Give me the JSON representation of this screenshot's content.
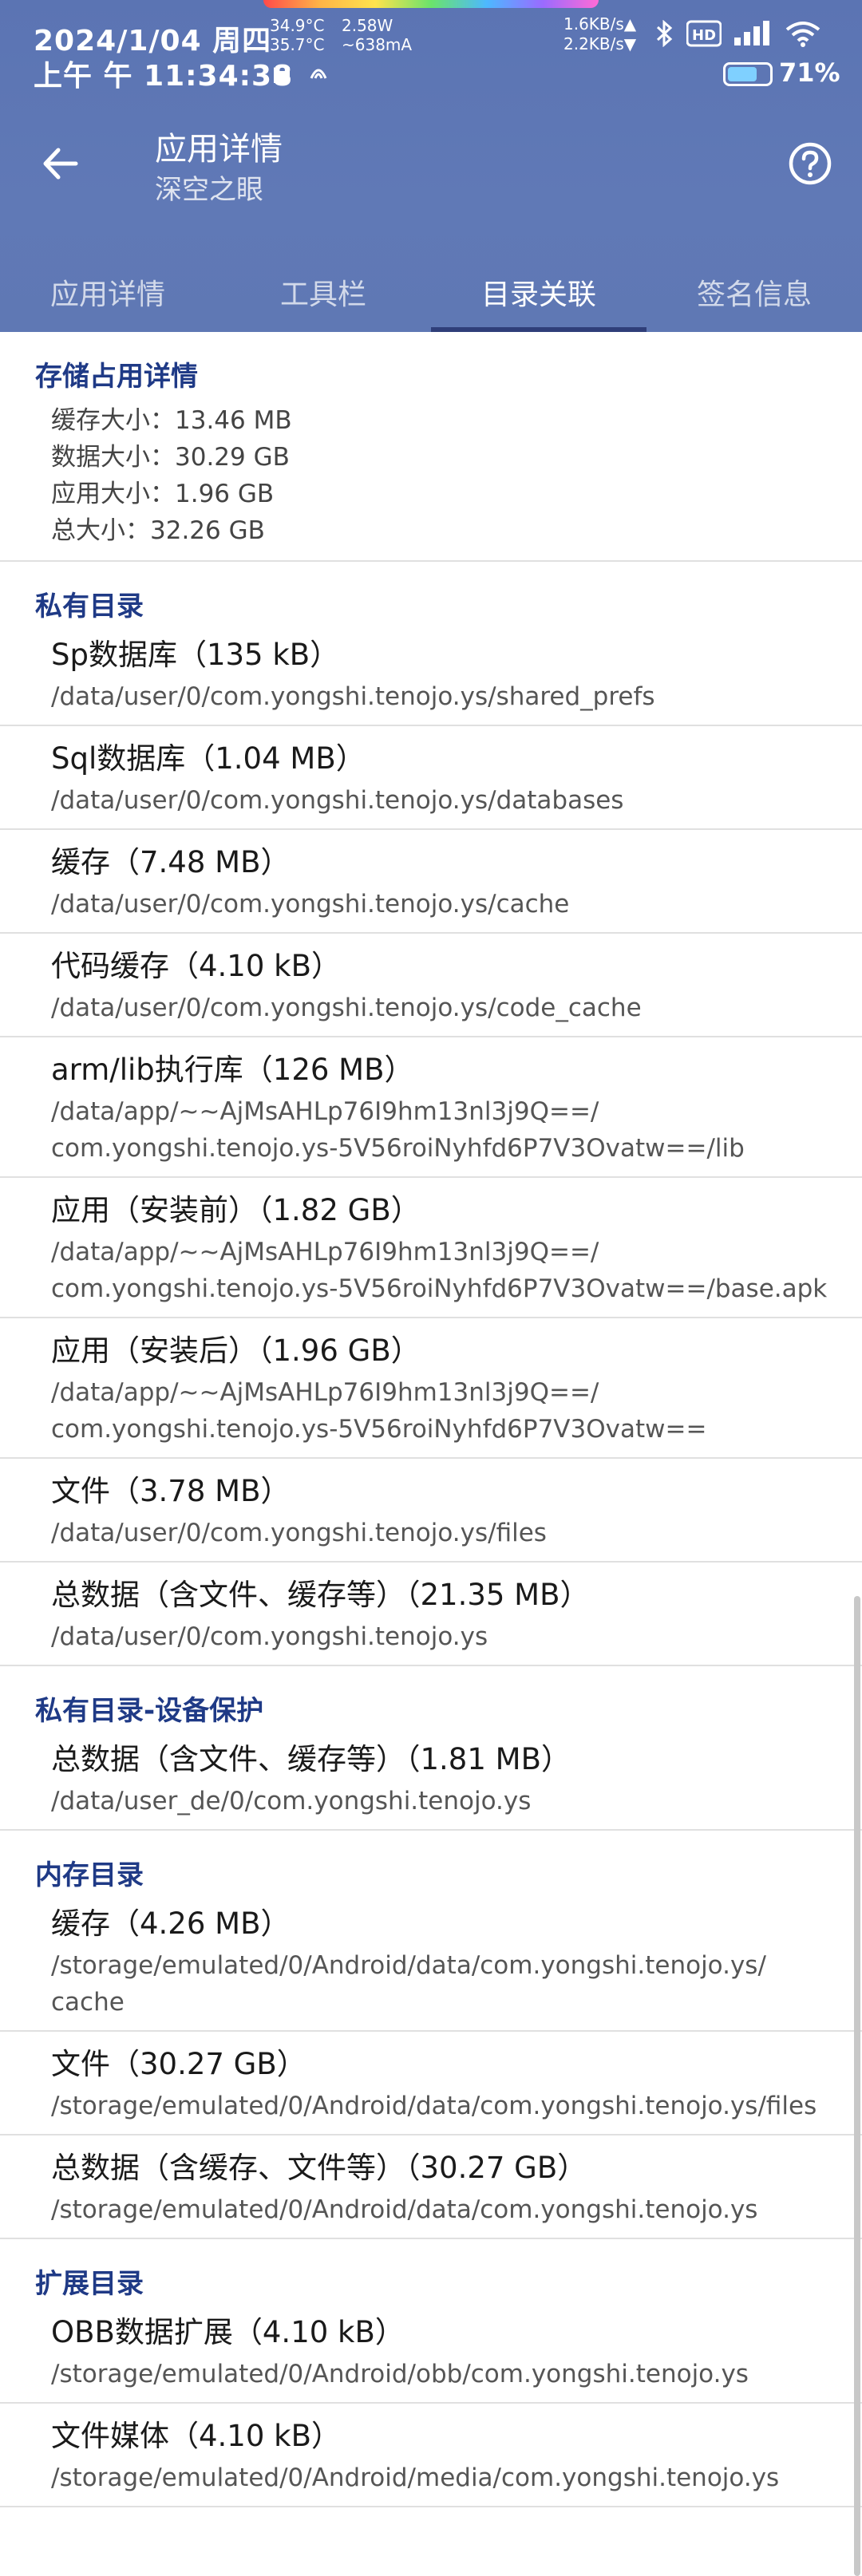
{
  "status_bar": {
    "date": "2024/1/04 周四",
    "time": "上午 午 11:34:38",
    "temp_top": "34.9°C",
    "temp_bottom": "35.7°C",
    "watt_top": "2.58W",
    "watt_bottom": "~638mA",
    "speed_up": "1.6KB/s▲",
    "speed_down": "2.2KB/s▼",
    "hd_label": "HD",
    "battery_percent": "71%",
    "battery_level": 0.71,
    "battery_color": "#7fd0ff",
    "icons": [
      "bluetooth-icon",
      "hd-icon",
      "signal-icon",
      "wifi-icon",
      "cat-icon",
      "nfc-icon"
    ]
  },
  "header": {
    "title": "应用详情",
    "subtitle": "深空之眼",
    "accent_color": "#5b74b3"
  },
  "tabs": [
    {
      "label": "应用详情",
      "active": false
    },
    {
      "label": "工具栏",
      "active": false
    },
    {
      "label": "目录关联",
      "active": true
    },
    {
      "label": "签名信息",
      "active": false
    }
  ],
  "storage_section": {
    "title": "存储占用详情",
    "lines": [
      "缓存大小：13.46 MB",
      "数据大小：30.29 GB",
      "应用大小：1.96 GB",
      "总大小：32.26 GB"
    ]
  },
  "sections": [
    {
      "title": "私有目录",
      "items": [
        {
          "name": "Sp数据库（135 kB）",
          "path": "/data/user/0/com.yongshi.tenojo.ys/shared_prefs"
        },
        {
          "name": "Sql数据库（1.04 MB）",
          "path": "/data/user/0/com.yongshi.tenojo.ys/databases"
        },
        {
          "name": "缓存（7.48 MB）",
          "path": "/data/user/0/com.yongshi.tenojo.ys/cache"
        },
        {
          "name": "代码缓存（4.10 kB）",
          "path": "/data/user/0/com.yongshi.tenojo.ys/code_cache"
        },
        {
          "name": "arm/lib执行库（126 MB）",
          "path": "/data/app/~~AjMsAHLp76I9hm13nl3j9Q==/\ncom.yongshi.tenojo.ys-5V56roiNyhfd6P7V3Ovatw==/lib"
        },
        {
          "name": "应用（安装前）（1.82 GB）",
          "path": "/data/app/~~AjMsAHLp76I9hm13nl3j9Q==/\ncom.yongshi.tenojo.ys-5V56roiNyhfd6P7V3Ovatw==/base.apk"
        },
        {
          "name": "应用（安装后）（1.96 GB）",
          "path": "/data/app/~~AjMsAHLp76I9hm13nl3j9Q==/\ncom.yongshi.tenojo.ys-5V56roiNyhfd6P7V3Ovatw=="
        },
        {
          "name": "文件（3.78 MB）",
          "path": "/data/user/0/com.yongshi.tenojo.ys/files"
        },
        {
          "name": "总数据（含文件、缓存等）（21.35 MB）",
          "path": "/data/user/0/com.yongshi.tenojo.ys"
        }
      ]
    },
    {
      "title": "私有目录-设备保护",
      "items": [
        {
          "name": "总数据（含文件、缓存等）（1.81 MB）",
          "path": "/data/user_de/0/com.yongshi.tenojo.ys"
        }
      ]
    },
    {
      "title": "内存目录",
      "items": [
        {
          "name": "缓存（4.26 MB）",
          "path": "/storage/emulated/0/Android/data/com.yongshi.tenojo.ys/\ncache"
        },
        {
          "name": "文件（30.27 GB）",
          "path": "/storage/emulated/0/Android/data/com.yongshi.tenojo.ys/files"
        },
        {
          "name": "总数据（含缓存、文件等）（30.27 GB）",
          "path": "/storage/emulated/0/Android/data/com.yongshi.tenojo.ys"
        }
      ]
    },
    {
      "title": "扩展目录",
      "items": [
        {
          "name": "OBB数据扩展（4.10 kB）",
          "path": "/storage/emulated/0/Android/obb/com.yongshi.tenojo.ys"
        },
        {
          "name": "文件媒体（4.10 kB）",
          "path": "/storage/emulated/0/Android/media/com.yongshi.tenojo.ys"
        }
      ]
    }
  ]
}
